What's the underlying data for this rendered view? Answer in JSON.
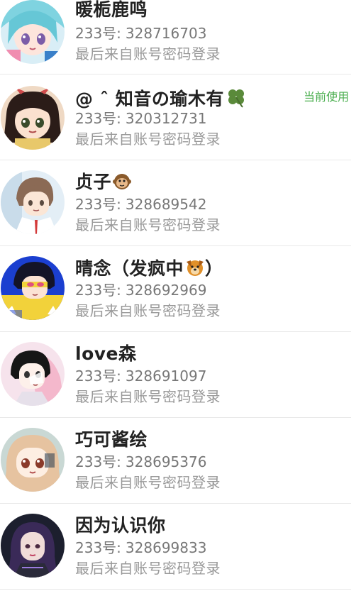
{
  "accounts": [
    {
      "name": "暖栀鹿鸣",
      "name_emoji": "",
      "id_prefix": "233号:",
      "id_number": "328716703",
      "login_hint": "最后来自账号密码登录",
      "avatar": "anime-girl-cyan-hair"
    },
    {
      "name": "@ ˆ 知音の瑜木有",
      "name_emoji": "four-leaf-clover",
      "id_prefix": "233号:",
      "id_number": "320312731",
      "login_hint": "最后来自账号密码登录",
      "avatar": "anime-girl-dark-hair-bow",
      "badge": "当前使用"
    },
    {
      "name": "贞子",
      "name_emoji": "monkey-face",
      "id_prefix": "233号:",
      "id_number": "328689542",
      "login_hint": "最后来自账号密码登录",
      "avatar": "anime-boy-brown-hair"
    },
    {
      "name": "晴念（发疯中",
      "name_suffix": "）",
      "name_emoji": "dog-face",
      "id_prefix": "233号:",
      "id_number": "328692969",
      "login_hint": "最后来自账号密码登录",
      "avatar": "anime-boy-yellow-background"
    },
    {
      "name": "love森",
      "name_emoji": "",
      "id_prefix": "233号:",
      "id_number": "328691097",
      "login_hint": "最后来自账号密码登录",
      "avatar": "anime-boy-pink-background"
    },
    {
      "name": "巧可酱绘",
      "name_emoji": "",
      "id_prefix": "233号:",
      "id_number": "328695376",
      "login_hint": "最后来自账号密码登录",
      "avatar": "anime-girl-light-hair"
    },
    {
      "name": "因为认识你",
      "name_emoji": "",
      "id_prefix": "233号:",
      "id_number": "328699833",
      "login_hint": "最后来自账号密码登录",
      "avatar": "game-character-purple-hair"
    }
  ],
  "colors": {
    "name": "#222222",
    "id_text": "#777777",
    "login_text": "#999999",
    "current_badge": "#4caf50",
    "divider": "#e8e8e8"
  }
}
